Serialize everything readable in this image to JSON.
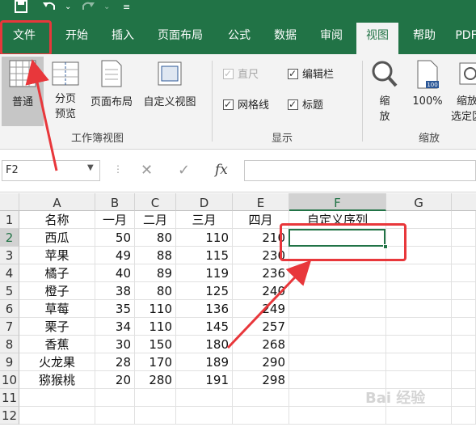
{
  "quick_access": {
    "save_icon": "save-icon",
    "undo_icon": "undo-icon",
    "redo_icon": "redo-icon",
    "customize_icon": "customize-icon"
  },
  "tabs": [
    "文件",
    "开始",
    "插入",
    "页面布局",
    "公式",
    "数据",
    "审阅",
    "视图",
    "帮助",
    "PDF"
  ],
  "active_tab": "视图",
  "ribbon": {
    "workbook_views": {
      "label": "工作簿视图",
      "normal": "普通",
      "page_break": [
        "分页",
        "预览"
      ],
      "page_layout": "页面布局",
      "custom_views": "自定义视图"
    },
    "show": {
      "label": "显示",
      "ruler": "直尺",
      "formula_bar": "编辑栏",
      "gridlines": "网格线",
      "headings": "标题"
    },
    "zoom": {
      "label": "缩放",
      "zoom": [
        "缩",
        "放"
      ],
      "hundred": "100%",
      "zoom_selection": [
        "缩放",
        "选定区"
      ]
    }
  },
  "formula_bar": {
    "name_box": "F2",
    "cancel": "✕",
    "enter": "✓",
    "fx": "fx",
    "value": ""
  },
  "sheet": {
    "columns": [
      "A",
      "B",
      "C",
      "D",
      "E",
      "F",
      "G"
    ],
    "rows": [
      "1",
      "2",
      "3",
      "4",
      "5",
      "6",
      "7",
      "8",
      "9",
      "10",
      "11",
      "12"
    ],
    "header": [
      "名称",
      "一月",
      "二月",
      "三月",
      "四月",
      "自定义序列"
    ],
    "data": [
      [
        "西瓜",
        "50",
        "80",
        "110",
        "210"
      ],
      [
        "苹果",
        "49",
        "88",
        "115",
        "230"
      ],
      [
        "橘子",
        "40",
        "89",
        "119",
        "236"
      ],
      [
        "橙子",
        "38",
        "80",
        "125",
        "240"
      ],
      [
        "草莓",
        "35",
        "110",
        "136",
        "249"
      ],
      [
        "栗子",
        "34",
        "110",
        "145",
        "257"
      ],
      [
        "香蕉",
        "30",
        "150",
        "180",
        "268"
      ],
      [
        "火龙果",
        "28",
        "170",
        "189",
        "290"
      ],
      [
        "猕猴桃",
        "20",
        "280",
        "191",
        "298"
      ]
    ],
    "active_cell": "F2"
  },
  "watermark": "Bai 经验",
  "colors": {
    "excel_green": "#217346",
    "highlight_red": "#e8373b"
  }
}
